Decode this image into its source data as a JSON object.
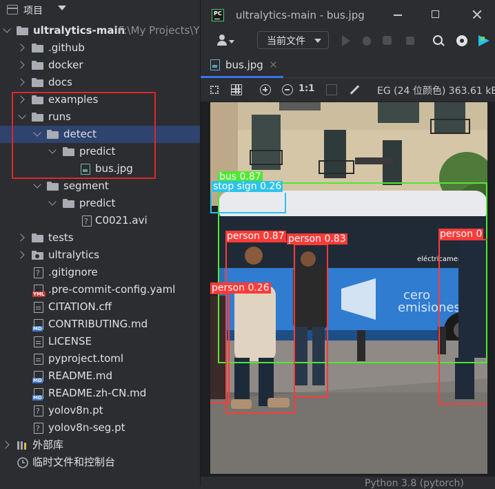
{
  "project_panel": {
    "title": "项目",
    "tree": [
      {
        "label": "ultralytics-main",
        "path": "F:\\My Projects\\Y",
        "type": "folder",
        "expanded": true,
        "bold": true
      },
      {
        "label": ".github",
        "type": "folder"
      },
      {
        "label": "docker",
        "type": "folder"
      },
      {
        "label": "docs",
        "type": "folder"
      },
      {
        "label": "examples",
        "type": "folder"
      },
      {
        "label": "runs",
        "type": "folder",
        "expanded": true
      },
      {
        "label": "detect",
        "type": "folder",
        "expanded": true,
        "selected": true
      },
      {
        "label": "predict",
        "type": "folder",
        "expanded": true
      },
      {
        "label": "bus.jpg",
        "type": "image"
      },
      {
        "label": "segment",
        "type": "folder",
        "expanded": true
      },
      {
        "label": "predict",
        "type": "folder",
        "expanded": true
      },
      {
        "label": "C0021.avi",
        "type": "unknown"
      },
      {
        "label": "tests",
        "type": "folder"
      },
      {
        "label": "ultralytics",
        "type": "package"
      },
      {
        "label": ".gitignore",
        "type": "unknown"
      },
      {
        "label": ".pre-commit-config.yaml",
        "type": "yaml",
        "badge": "YML"
      },
      {
        "label": "CITATION.cff",
        "type": "text"
      },
      {
        "label": "CONTRIBUTING.md",
        "type": "markdown",
        "badge": "MD"
      },
      {
        "label": "LICENSE",
        "type": "text"
      },
      {
        "label": "pyproject.toml",
        "type": "text"
      },
      {
        "label": "README.md",
        "type": "markdown",
        "badge": "MD"
      },
      {
        "label": "README.zh-CN.md",
        "type": "markdown",
        "badge": "MD"
      },
      {
        "label": "yolov8n.pt",
        "type": "unknown"
      },
      {
        "label": "yolov8n-seg.pt",
        "type": "unknown"
      },
      {
        "label": "外部库",
        "type": "library"
      },
      {
        "label": "临时文件和控制台",
        "type": "scratches"
      }
    ]
  },
  "editor": {
    "app_logo": "PC",
    "window_title": "ultralytics-main - bus.jpg",
    "run_config": "当前文件",
    "tab": {
      "label": "bus.jpg"
    },
    "image_toolbar": {
      "actual_size": "1:1",
      "info": "EG (24 位颜色) 363.61 kB"
    },
    "detections": [
      {
        "label": "bus 0.87",
        "color": "#50e832"
      },
      {
        "label": "stop sign 0.26",
        "color": "#2dc3e8"
      },
      {
        "label": "person 0.87",
        "color": "#ff3b38"
      },
      {
        "label": "person 0.83",
        "color": "#ff3b38"
      },
      {
        "label": "person 0.26",
        "color": "#ff3b38"
      },
      {
        "label": "person 0",
        "color": "#ff3b38"
      }
    ],
    "status": {
      "interpreter": "Python 3.8 (pytorch)"
    }
  },
  "icons": {
    "project": "panel-icon",
    "folder": "folder-icon",
    "file": "file-icon",
    "run": "run-icon",
    "debug": "debug-icon",
    "search": "search-icon",
    "settings": "gear-icon"
  },
  "colors": {
    "panel_bg": "#2b2d30",
    "selection": "#2e436e",
    "annotation_red": "#e0262b",
    "accent": "#3574f0"
  }
}
